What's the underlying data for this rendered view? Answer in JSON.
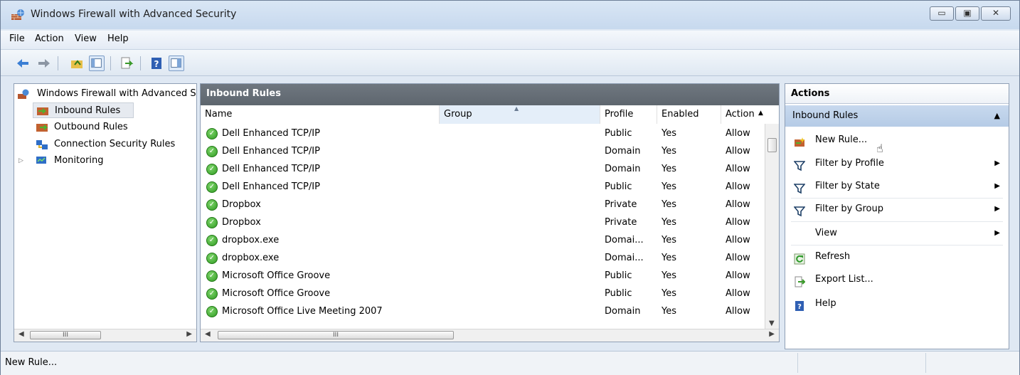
{
  "window": {
    "title": "Windows Firewall with Advanced Security"
  },
  "menu": [
    "File",
    "Action",
    "View",
    "Help"
  ],
  "tree": {
    "root": "Windows Firewall with Advanced Security",
    "items": [
      {
        "label": "Inbound Rules",
        "selected": true
      },
      {
        "label": "Outbound Rules"
      },
      {
        "label": "Connection Security Rules"
      },
      {
        "label": "Monitoring",
        "expandable": true
      }
    ]
  },
  "center": {
    "title": "Inbound Rules",
    "columns": [
      "Name",
      "Group",
      "Profile",
      "Enabled",
      "Action"
    ],
    "rows": [
      {
        "name": "Dell Enhanced TCP/IP",
        "group": "",
        "profile": "Public",
        "enabled": "Yes",
        "action": "Allow"
      },
      {
        "name": "Dell Enhanced TCP/IP",
        "group": "",
        "profile": "Domain",
        "enabled": "Yes",
        "action": "Allow"
      },
      {
        "name": "Dell Enhanced TCP/IP",
        "group": "",
        "profile": "Domain",
        "enabled": "Yes",
        "action": "Allow"
      },
      {
        "name": "Dell Enhanced TCP/IP",
        "group": "",
        "profile": "Public",
        "enabled": "Yes",
        "action": "Allow"
      },
      {
        "name": "Dropbox",
        "group": "",
        "profile": "Private",
        "enabled": "Yes",
        "action": "Allow"
      },
      {
        "name": "Dropbox",
        "group": "",
        "profile": "Private",
        "enabled": "Yes",
        "action": "Allow"
      },
      {
        "name": "dropbox.exe",
        "group": "",
        "profile": "Domai...",
        "enabled": "Yes",
        "action": "Allow"
      },
      {
        "name": "dropbox.exe",
        "group": "",
        "profile": "Domai...",
        "enabled": "Yes",
        "action": "Allow"
      },
      {
        "name": "Microsoft Office Groove",
        "group": "",
        "profile": "Public",
        "enabled": "Yes",
        "action": "Allow"
      },
      {
        "name": "Microsoft Office Groove",
        "group": "",
        "profile": "Public",
        "enabled": "Yes",
        "action": "Allow"
      },
      {
        "name": "Microsoft Office Live Meeting 2007",
        "group": "",
        "profile": "Domain",
        "enabled": "Yes",
        "action": "Allow"
      }
    ]
  },
  "actions": {
    "title": "Actions",
    "section": "Inbound Rules",
    "items": [
      {
        "label": "New Rule...",
        "icon": "new-rule-icon"
      },
      {
        "label": "Filter by Profile",
        "icon": "filter-icon",
        "submenu": true
      },
      {
        "label": "Filter by State",
        "icon": "filter-icon",
        "submenu": true
      },
      {
        "label": "Filter by Group",
        "icon": "filter-icon",
        "submenu": true
      },
      {
        "label": "View",
        "icon": "",
        "submenu": true
      },
      {
        "label": "Refresh",
        "icon": "refresh-icon"
      },
      {
        "label": "Export List...",
        "icon": "export-icon"
      },
      {
        "label": "Help",
        "icon": "help-icon"
      }
    ]
  },
  "status": {
    "text": "New Rule..."
  },
  "colors": {
    "check_green": "#2f9a21",
    "header_gray": "#5e666e",
    "actions_section": "#b5cbe6"
  }
}
